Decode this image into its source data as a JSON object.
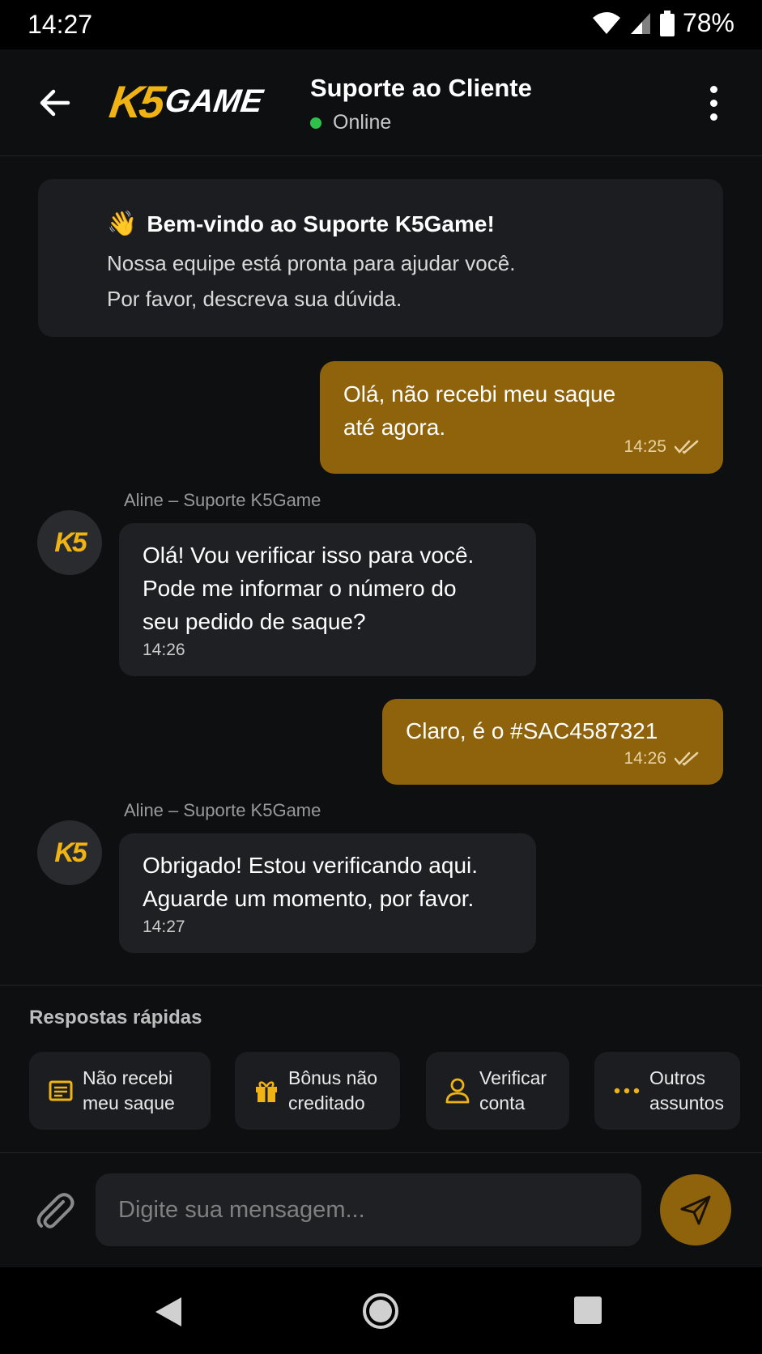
{
  "status_bar": {
    "time": "14:27",
    "battery": "78%"
  },
  "header": {
    "logo_k5": "K5",
    "logo_game": "GAME",
    "title": "Suporte ao Cliente",
    "status": "Online"
  },
  "welcome": {
    "emoji": "👋",
    "title": "Bem-vindo ao Suporte K5Game!",
    "line1": "Nossa equipe está pronta para ajudar você.",
    "line2": "Por favor, descreva sua dúvida."
  },
  "messages": [
    {
      "direction": "out",
      "line1": "Olá, não recebi meu saque",
      "line2": "até agora.",
      "time": "14:25",
      "status_icon": "double-check-icon"
    },
    {
      "direction": "in",
      "sender": "Aline – Suporte K5Game",
      "avatar_text": "K5",
      "line1": "Olá! Vou verificar isso para você.",
      "line2": "Pode me informar o número do",
      "line3": "seu pedido de saque?",
      "time": "14:26"
    },
    {
      "direction": "out",
      "line1": "Claro, é o #SAC4587321",
      "time": "14:26",
      "status_icon": "double-check-icon"
    },
    {
      "direction": "in",
      "sender": "Aline – Suporte K5Game",
      "avatar_text": "K5",
      "line1": "Obrigado! Estou verificando aqui.",
      "line2": "Aguarde um momento, por favor.",
      "time": "14:27"
    }
  ],
  "quick_replies": {
    "title": "Respostas rápidas",
    "items": [
      {
        "icon": "receipt-icon",
        "line1": "Não recebi",
        "line2": "meu saque"
      },
      {
        "icon": "gift-icon",
        "line1": "Bônus não",
        "line2": "creditado"
      },
      {
        "icon": "user-icon",
        "line1": "Verificar",
        "line2": "conta"
      },
      {
        "icon": "more-dots-icon",
        "line1": "Outros",
        "line2": "assuntos"
      }
    ]
  },
  "composer": {
    "placeholder": "Digite sua mensagem..."
  },
  "colors": {
    "accent": "#f0b314",
    "bubble_out": "#8e630b",
    "bubble_in": "#1f2024",
    "online": "#2fc24a",
    "background": "#0e0f11"
  }
}
